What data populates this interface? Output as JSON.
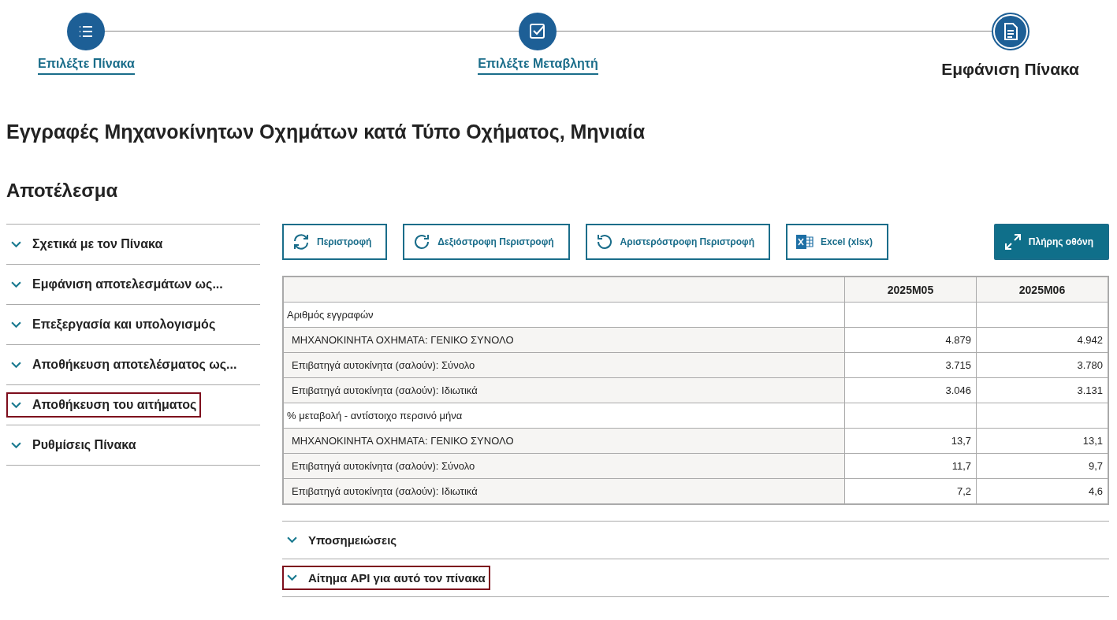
{
  "stepper": [
    {
      "label": "Επιλέξτε Πίνακα",
      "current": false
    },
    {
      "label": "Επιλέξτε Μεταβλητή",
      "current": false
    },
    {
      "label": "Εμφάνιση Πίνακα",
      "current": true
    }
  ],
  "title": "Εγγραφές Μηχανοκίνητων Οχημάτων κατά Τύπο Οχήματος, Μηνιαία",
  "subtitle": "Αποτέλεσμα",
  "sidebar": {
    "items": [
      {
        "label": "Σχετικά με τον Πίνακα",
        "highlighted": false
      },
      {
        "label": "Εμφάνιση αποτελεσμάτων ως...",
        "highlighted": false
      },
      {
        "label": "Επεξεργασία και υπολογισμός",
        "highlighted": false
      },
      {
        "label": "Αποθήκευση αποτελέσματος ως...",
        "highlighted": false
      },
      {
        "label": "Αποθήκευση του αιτήματος",
        "highlighted": true
      },
      {
        "label": "Ρυθμίσεις Πίνακα",
        "highlighted": false
      }
    ]
  },
  "toolbar": [
    {
      "label": "Περιστροφή",
      "primary": false
    },
    {
      "label": "Δεξιόστροφη Περιστροφή",
      "primary": false
    },
    {
      "label": "Αριστερόστροφη Περιστροφή",
      "primary": false
    },
    {
      "label": "Excel (xlsx)",
      "primary": false
    },
    {
      "label": "Πλήρης οθόνη",
      "primary": true
    }
  ],
  "table": {
    "columns": [
      "2025M05",
      "2025M06"
    ],
    "rows": [
      {
        "kind": "group",
        "label": "Αριθμός εγγραφών",
        "values": []
      },
      {
        "kind": "data",
        "label": "ΜΗΧΑΝΟΚΙΝΗΤΑ ΟΧΗΜΑΤΑ: ΓΕΝΙΚΟ ΣΥΝΟΛΟ",
        "values": [
          "4.879",
          "4.942"
        ]
      },
      {
        "kind": "data",
        "label": "Επιβατηγά αυτοκίνητα (σαλούν): Σύνολο",
        "values": [
          "3.715",
          "3.780"
        ]
      },
      {
        "kind": "data",
        "label": "Επιβατηγά αυτοκίνητα (σαλούν): Ιδιωτικά",
        "values": [
          "3.046",
          "3.131"
        ]
      },
      {
        "kind": "group",
        "label": "% μεταβολή - αντίστοιχο περσινό μήνα",
        "values": []
      },
      {
        "kind": "data",
        "label": "ΜΗΧΑΝΟΚΙΝΗΤΑ ΟΧΗΜΑΤΑ: ΓΕΝΙΚΟ ΣΥΝΟΛΟ",
        "values": [
          "13,7",
          "13,1"
        ]
      },
      {
        "kind": "data",
        "label": "Επιβατηγά αυτοκίνητα (σαλούν): Σύνολο",
        "values": [
          "11,7",
          "9,7"
        ]
      },
      {
        "kind": "data",
        "label": "Επιβατηγά αυτοκίνητα (σαλούν): Ιδιωτικά",
        "values": [
          "7,2",
          "4,6"
        ]
      }
    ]
  },
  "sections": [
    {
      "label": "Υποσημειώσεις",
      "highlighted": false
    },
    {
      "label": "Αίτημα API για αυτό τον πίνακα",
      "highlighted": true
    }
  ]
}
